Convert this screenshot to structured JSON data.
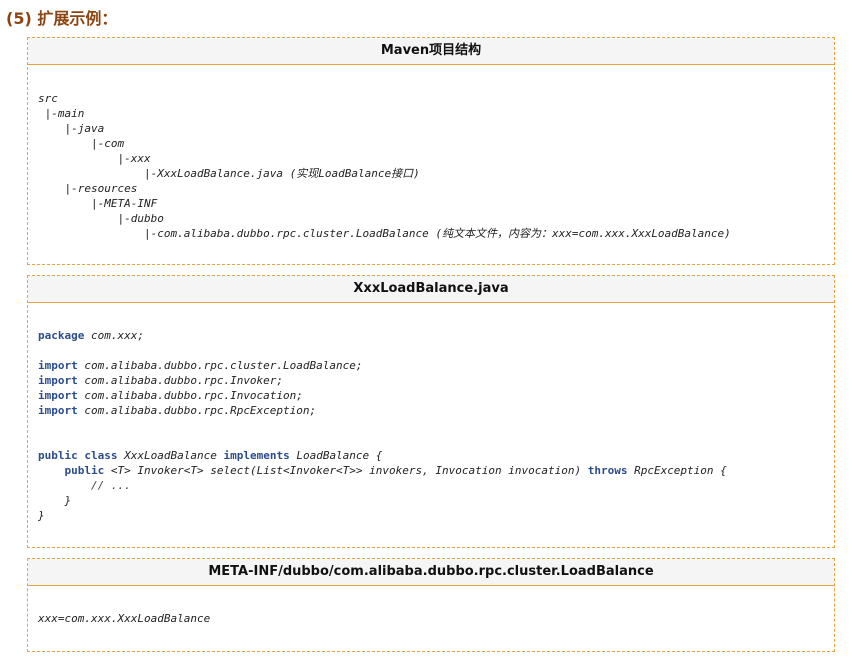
{
  "heading": "(5) 扩展示例：",
  "panels": [
    {
      "title": "Maven项目结构",
      "lines": [
        "src",
        " |-main",
        "    |-java",
        "        |-com",
        "            |-xxx",
        "                |-XxxLoadBalance.java (实现LoadBalance接口)",
        "    |-resources",
        "        |-META-INF",
        "            |-dubbo",
        "                |-com.alibaba.dubbo.rpc.cluster.LoadBalance (纯文本文件，内容为：xxx=com.xxx.XxxLoadBalance)"
      ]
    },
    {
      "title": "XxxLoadBalance.java",
      "code": {
        "package_kw": "package",
        "package_name": " com.xxx;",
        "import_kw": "import",
        "imports": [
          " com.alibaba.dubbo.rpc.cluster.LoadBalance;",
          " com.alibaba.dubbo.rpc.Invoker;",
          " com.alibaba.dubbo.rpc.Invocation;",
          " com.alibaba.dubbo.rpc.RpcException;"
        ],
        "public_kw": "public",
        "class_kw": "class",
        "class_name": " XxxLoadBalance ",
        "implements_kw": "implements",
        "iface": " LoadBalance {",
        "method_sig": " <T> Invoker<T> select(List<Invoker<T>> invokers, Invocation invocation) ",
        "throws_kw": "throws",
        "throws_rest": " RpcException {",
        "comment": "        // ...",
        "close_method": "    }",
        "close_class": "}"
      }
    },
    {
      "title": "META-INF/dubbo/com.alibaba.dubbo.rpc.cluster.LoadBalance",
      "lines": [
        "xxx=com.xxx.XxxLoadBalance"
      ]
    }
  ]
}
